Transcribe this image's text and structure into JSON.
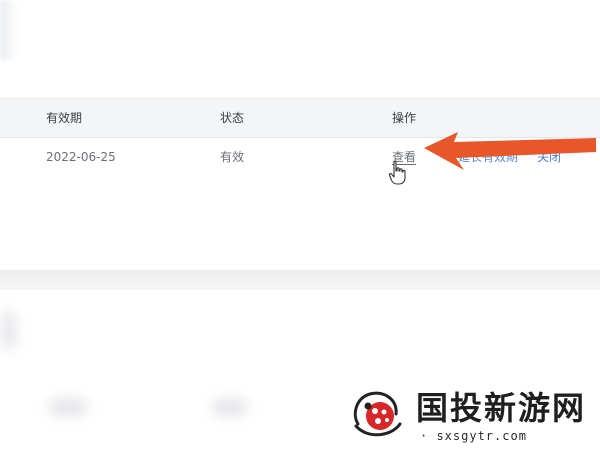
{
  "table": {
    "headers": {
      "validity": "有效期",
      "status": "状态",
      "actions": "操作"
    },
    "rows": [
      {
        "validity": "2022-06-25",
        "status": "有效",
        "actions": {
          "view": "查看",
          "renew_partial": "延长有效期",
          "close": "关闭"
        }
      }
    ]
  },
  "annotation": {
    "arrow_color": "#e8572a",
    "pointer_icon": "hand-pointer-icon"
  },
  "watermark": {
    "title": "国投新游网",
    "url": "www.sxsgytr.com",
    "url_visible": "· sxsgytr.com",
    "logo_icon": "ladybug-logo-icon",
    "logo_color": "#d9262b"
  },
  "colors": {
    "link": "#2e6fc2",
    "header_bg": "#f4f5f7"
  }
}
